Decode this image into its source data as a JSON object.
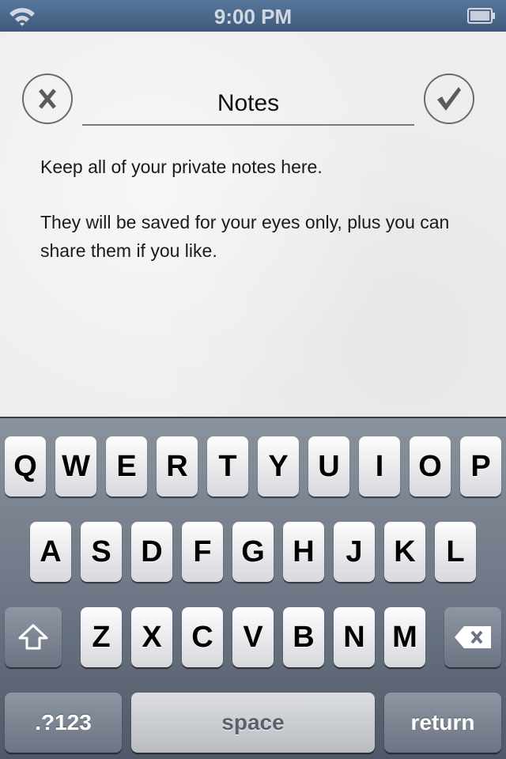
{
  "status_bar": {
    "time": "9:00 PM",
    "wifi_icon": "wifi-icon",
    "battery_icon": "battery-icon"
  },
  "note": {
    "title": "Notes",
    "cancel_icon": "x-icon",
    "done_icon": "checkmark-icon",
    "paragraphs": [
      "Keep all of your private notes here.",
      "They will be saved for your eyes only, plus you can share them if you like."
    ]
  },
  "keyboard": {
    "row1": [
      "Q",
      "W",
      "E",
      "R",
      "T",
      "Y",
      "U",
      "I",
      "O",
      "P"
    ],
    "row2": [
      "A",
      "S",
      "D",
      "F",
      "G",
      "H",
      "J",
      "K",
      "L"
    ],
    "row3": [
      "Z",
      "X",
      "C",
      "V",
      "B",
      "N",
      "M"
    ],
    "shift_icon": "shift-icon",
    "delete_icon": "backspace-icon",
    "numbers_label": ".?123",
    "space_label": "space",
    "return_label": "return"
  }
}
